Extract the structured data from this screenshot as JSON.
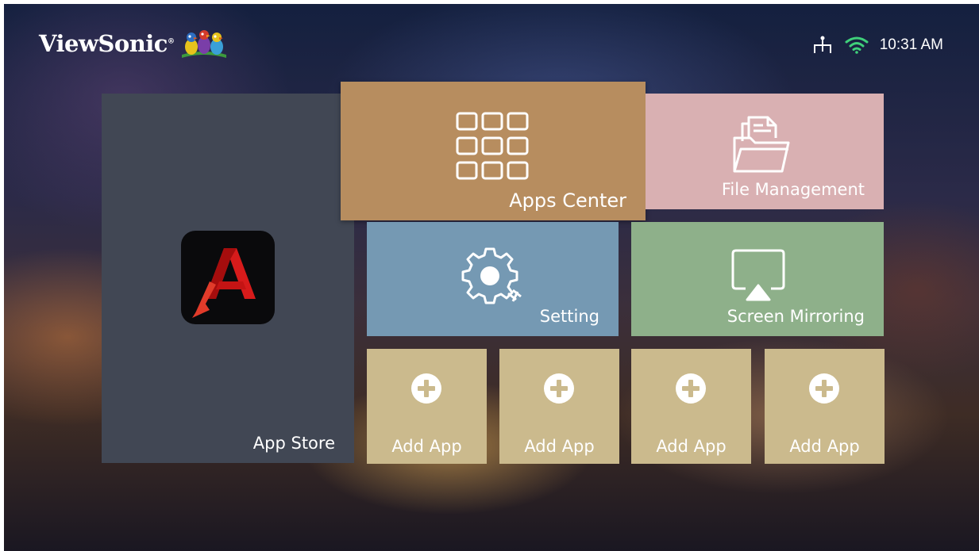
{
  "header": {
    "brand": "ViewSonic",
    "brand_mark": "®",
    "time": "10:31 AM"
  },
  "status_icons": [
    "network-icon",
    "wifi-icon"
  ],
  "tiles": {
    "app_store": {
      "label": "App Store",
      "icon": "app-store-logo-icon"
    },
    "apps_center": {
      "label": "Apps Center",
      "icon": "app-grid-icon"
    },
    "file_management": {
      "label": "File Management",
      "icon": "folder-documents-icon"
    },
    "setting": {
      "label": "Setting",
      "icon": "gear-icon"
    },
    "screen_mirroring": {
      "label": "Screen Mirroring",
      "icon": "airplay-icon"
    },
    "add_apps": [
      {
        "label": "Add App",
        "icon": "plus-circle-icon"
      },
      {
        "label": "Add App",
        "icon": "plus-circle-icon"
      },
      {
        "label": "Add App",
        "icon": "plus-circle-icon"
      },
      {
        "label": "Add App",
        "icon": "plus-circle-icon"
      }
    ]
  },
  "colors": {
    "app_store": "#414754",
    "apps_center": "#b78d5f",
    "file_management": "#d9b0b2",
    "setting": "#7599b3",
    "screen_mirroring": "#8eb08a",
    "add_app": "#cbba8d"
  }
}
